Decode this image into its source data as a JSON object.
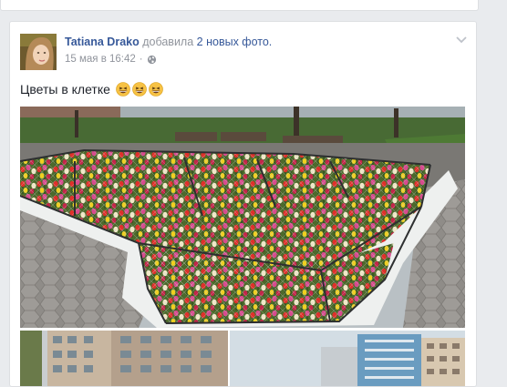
{
  "post": {
    "author_name": "Tatiana Drako",
    "action_text": "добавила",
    "photos_link": "2 новых фото.",
    "timestamp": "15 мая в 16:42",
    "separator": "·",
    "text": "Цветы в клетке",
    "emoji_count": 3,
    "icons": {
      "avatar": "profile-photo",
      "privacy": "globe-icon",
      "menu": "chevron-down-icon",
      "emoji": "grinning-squinting-face-emoji"
    }
  },
  "colors": {
    "link": "#365899",
    "meta": "#90949c",
    "background": "#e9ebee"
  }
}
